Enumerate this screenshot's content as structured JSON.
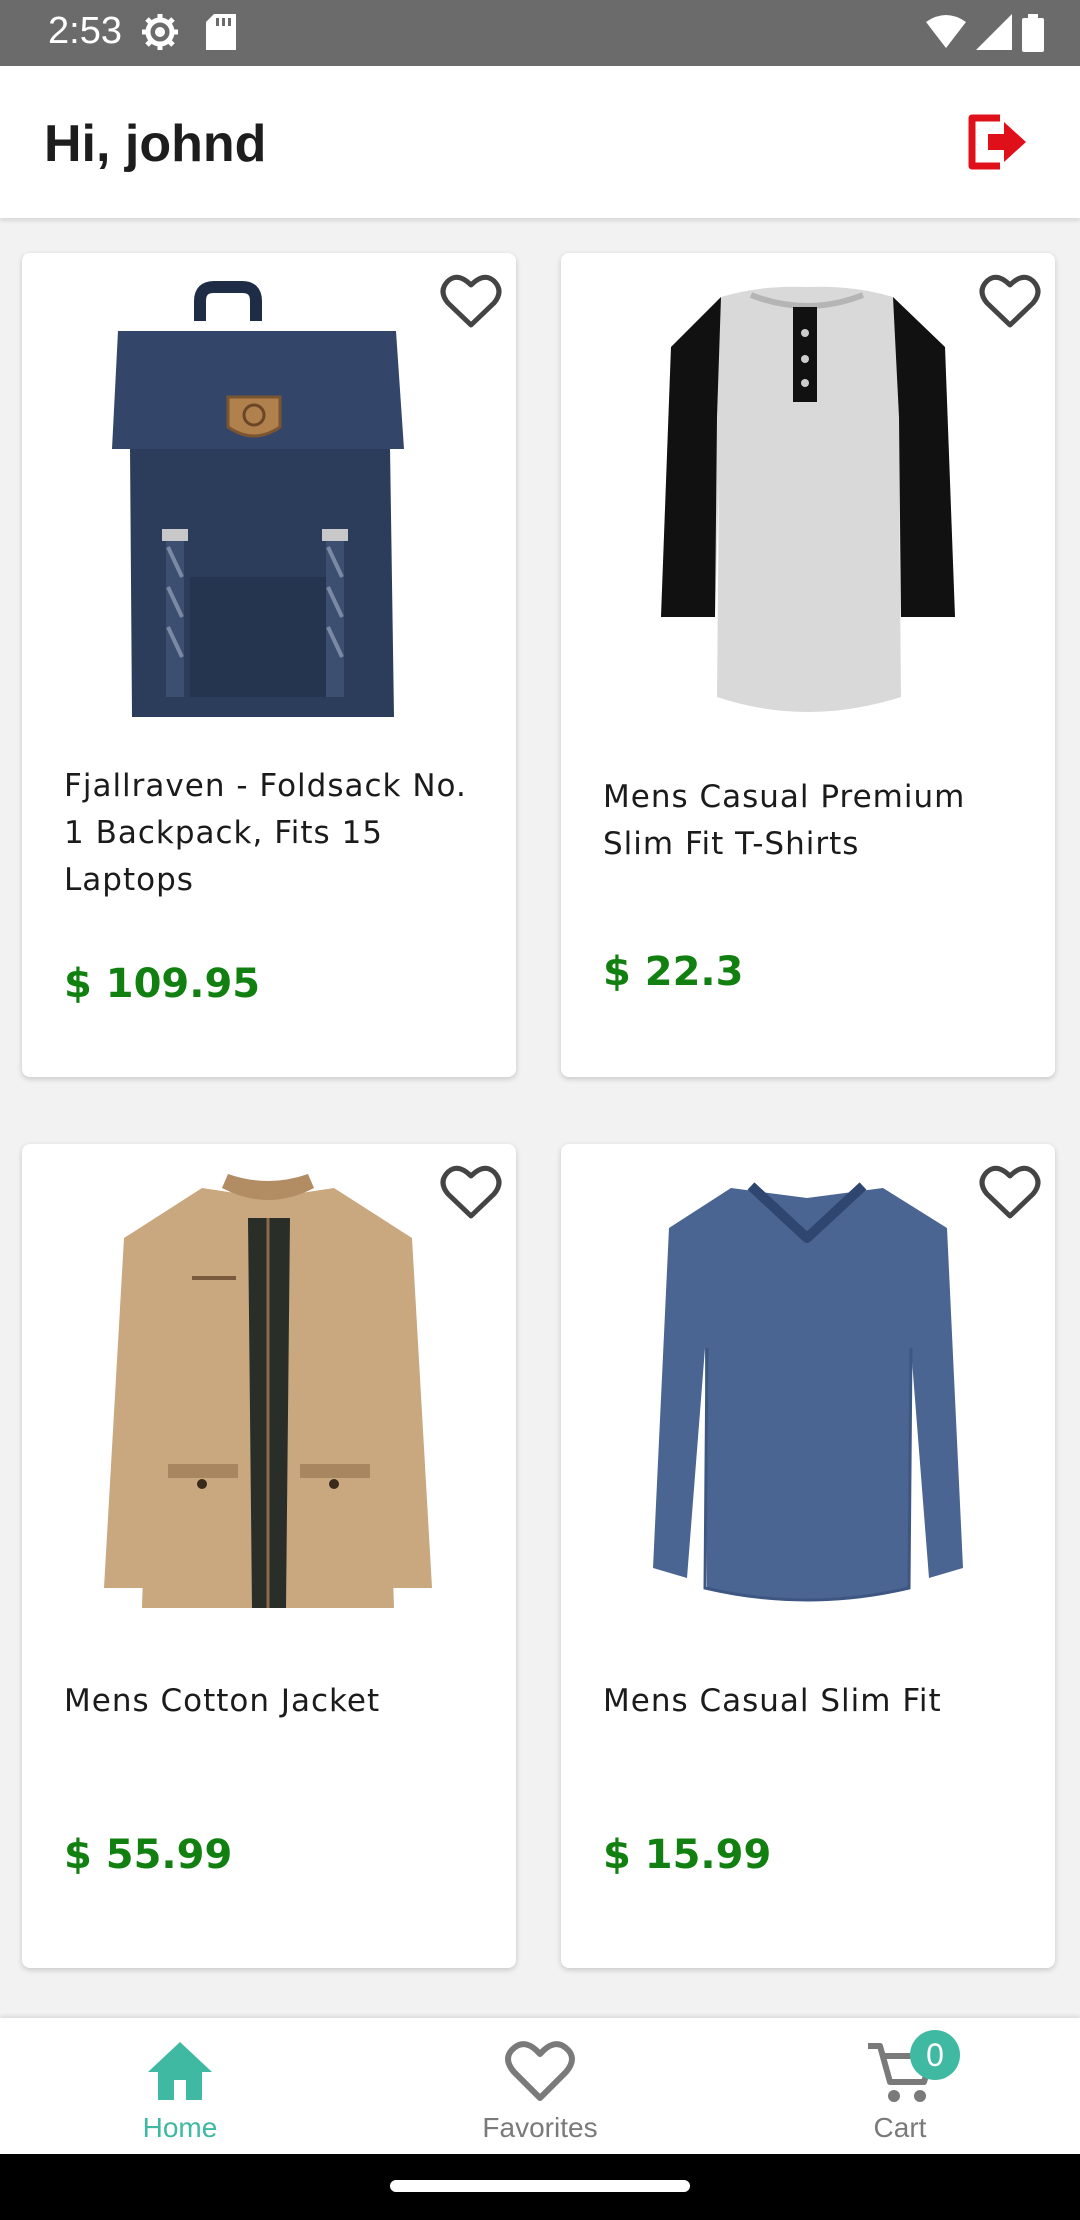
{
  "status_bar": {
    "time": "2:53"
  },
  "header": {
    "greeting": "Hi, johnd"
  },
  "products": [
    {
      "title": "Fjallraven - Foldsack No. 1 Backpack, Fits 15 Laptops",
      "price": "$ 109.95",
      "image": "backpack-image"
    },
    {
      "title": "Mens Casual Premium Slim Fit T-Shirts",
      "price": "$ 22.3",
      "image": "raglan-tshirt-image"
    },
    {
      "title": "Mens Cotton Jacket",
      "price": "$ 55.99",
      "image": "cotton-jacket-image"
    },
    {
      "title": "Mens Casual Slim Fit",
      "price": "$ 15.99",
      "image": "longsleeve-shirt-image"
    }
  ],
  "nav": {
    "home": "Home",
    "favorites": "Favorites",
    "cart": "Cart",
    "cart_count": "0"
  },
  "colors": {
    "accent": "#3fb9a2",
    "price": "#118011",
    "logout": "#e0101a"
  }
}
